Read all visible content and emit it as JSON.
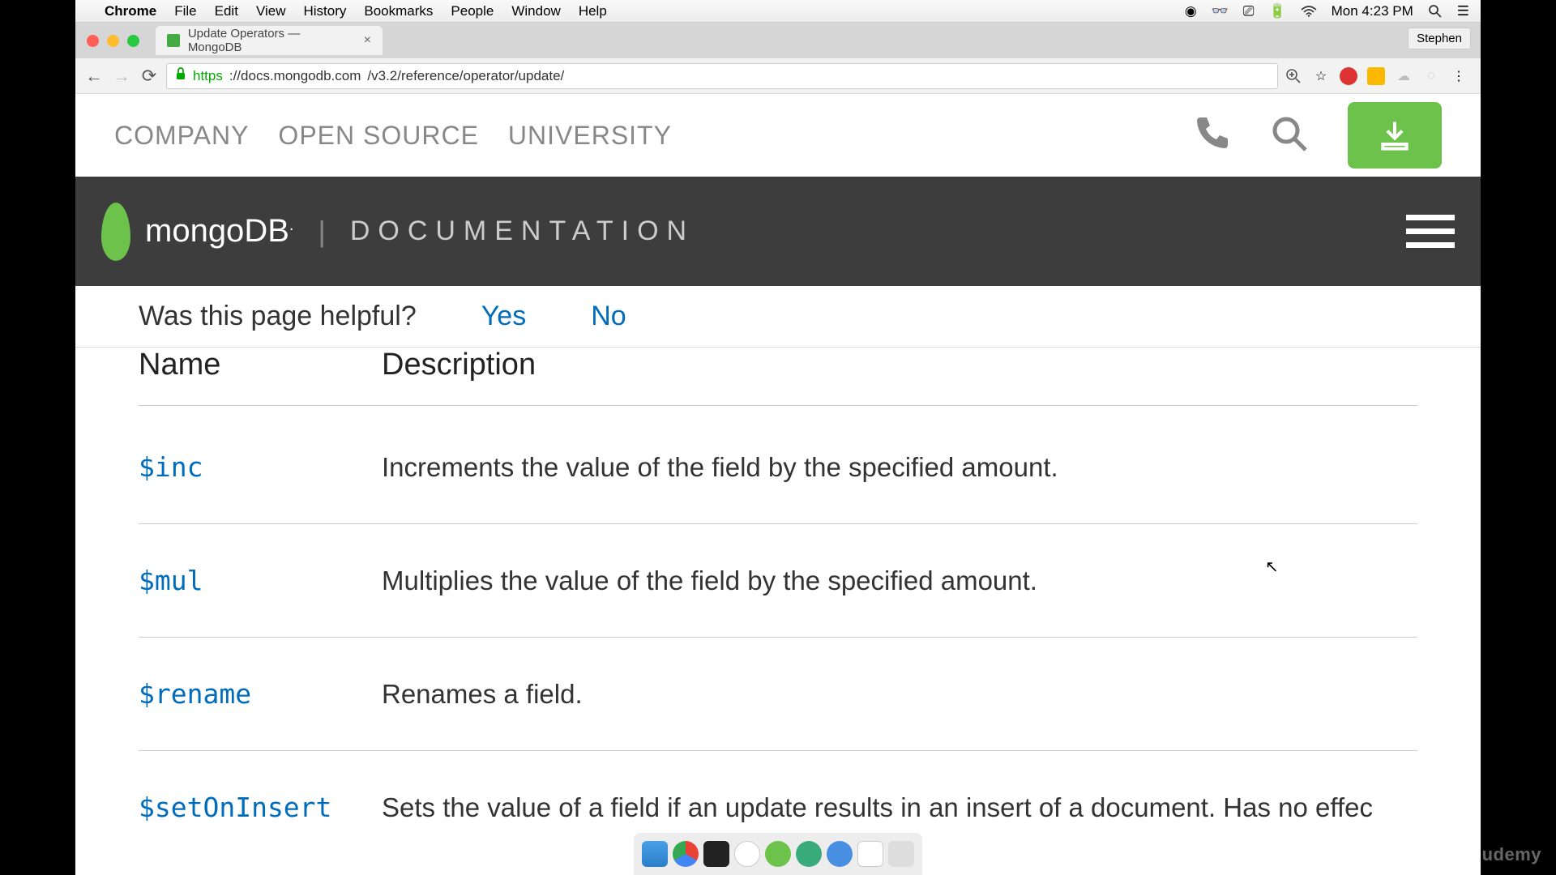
{
  "menubar": {
    "app": "Chrome",
    "items": [
      "File",
      "Edit",
      "View",
      "History",
      "Bookmarks",
      "People",
      "Window",
      "Help"
    ],
    "clock": "Mon 4:23 PM"
  },
  "chrome": {
    "tab_title": "Update Operators — MongoDB",
    "profile": "Stephen",
    "url_scheme": "https",
    "url_host": "://docs.mongodb.com",
    "url_path": "/v3.2/reference/operator/update/"
  },
  "topnav": {
    "links": [
      "COMPANY",
      "OPEN SOURCE",
      "UNIVERSITY"
    ]
  },
  "docheader": {
    "brand_mongo": "mongo",
    "brand_db": "DB",
    "brand_dot": ".",
    "label": "DOCUMENTATION"
  },
  "feedback": {
    "question": "Was this page helpful?",
    "yes": "Yes",
    "no": "No"
  },
  "table": {
    "col_name": "Name",
    "col_desc": "Description",
    "rows": [
      {
        "name": "$inc",
        "desc": "Increments the value of the field by the specified amount."
      },
      {
        "name": "$mul",
        "desc": "Multiplies the value of the field by the specified amount."
      },
      {
        "name": "$rename",
        "desc": "Renames a field."
      },
      {
        "name": "$setOnInsert",
        "desc": "Sets the value of a field if an update results in an insert of a document. Has no effec"
      }
    ]
  },
  "watermark": "udemy"
}
